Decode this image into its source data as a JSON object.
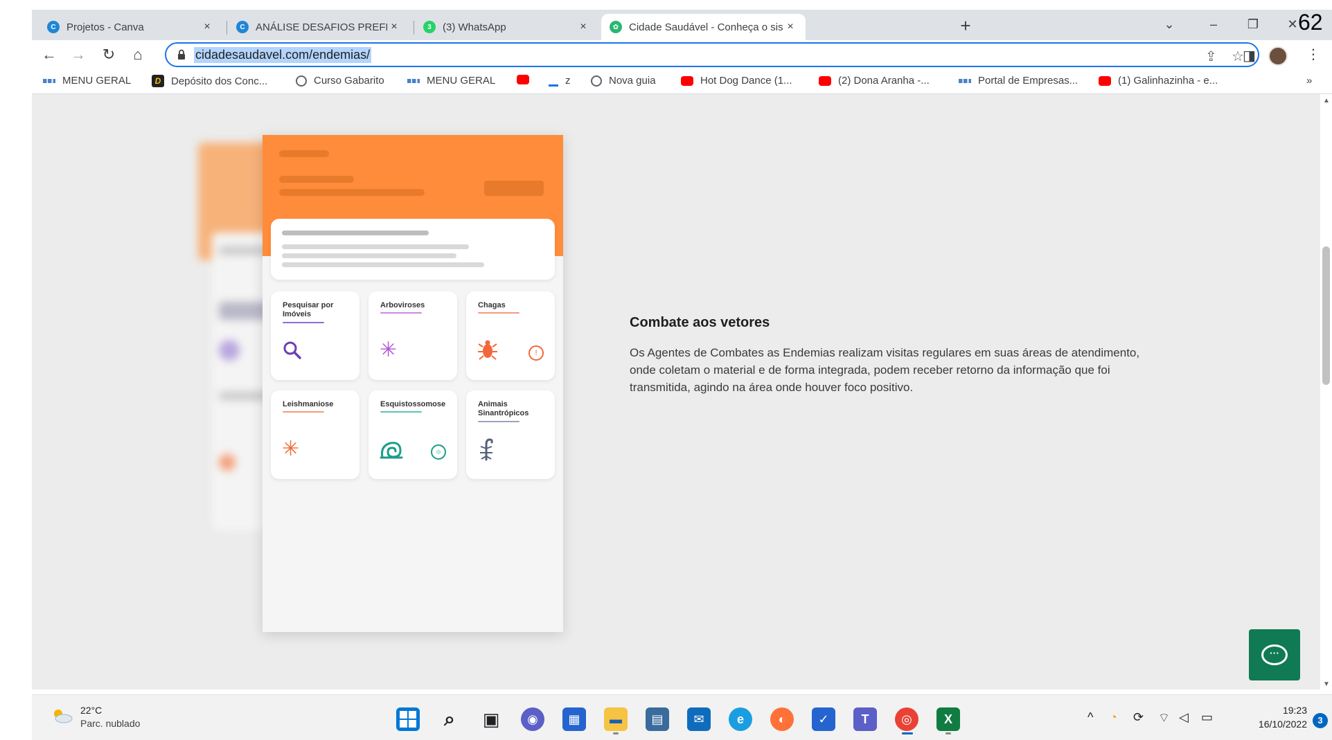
{
  "browser": {
    "tabs": [
      {
        "title": "Projetos - Canva",
        "icon": "canva-icon",
        "color": "#1f86d6",
        "active": false
      },
      {
        "title": "ANÁLISE DESAFIOS PREFEITURA",
        "icon": "canva-icon",
        "color": "#1f86d6",
        "active": false
      },
      {
        "title": "(3) WhatsApp",
        "icon": "whatsapp-icon",
        "color": "#25d366",
        "active": false
      },
      {
        "title": "Cidade Saudável - Conheça o sis",
        "icon": "cidade-saudavel-icon",
        "color": "#2bb673",
        "active": true
      }
    ],
    "close_glyph": "×",
    "new_tab_glyph": "+",
    "url": "cidadesaudavel.com/endemias/",
    "overlay_number": "62"
  },
  "bookmarks": [
    {
      "label": "MENU GERAL",
      "icon": "grid-icon"
    },
    {
      "label": "Depósito dos Conc...",
      "icon": "d-logo-icon"
    },
    {
      "label": "Curso Gabarito",
      "icon": "globe-icon"
    },
    {
      "label": "MENU GERAL",
      "icon": "grid-icon"
    },
    {
      "label": "",
      "icon": "youtube-icon"
    },
    {
      "label": "z",
      "icon": "download-icon"
    },
    {
      "label": "Nova guia",
      "icon": "globe-icon"
    },
    {
      "label": "Hot Dog Dance (1...",
      "icon": "youtube-icon"
    },
    {
      "label": "(2) Dona Aranha -...",
      "icon": "youtube-icon"
    },
    {
      "label": "Portal de Empresas...",
      "icon": "grid-icon"
    },
    {
      "label": "(1) Galinhazinha - e...",
      "icon": "youtube-icon"
    }
  ],
  "bookmarks_more": "»",
  "mockup": {
    "tiles": [
      {
        "label": "Pesquisar por Imóveis",
        "icon": "search-icon",
        "glyph": "🔍",
        "color": "#6a3fb5",
        "badge": ""
      },
      {
        "label": "Arboviroses",
        "icon": "mosquito-icon",
        "glyph": "✳",
        "color": "#b256d6",
        "badge": ""
      },
      {
        "label": "Chagas",
        "icon": "bug-icon",
        "glyph": "🐞",
        "color": "#f2683a",
        "badge": "!"
      },
      {
        "label": "Leishmaniose",
        "icon": "sandfly-icon",
        "glyph": "✳",
        "color": "#f2683a",
        "badge": ""
      },
      {
        "label": "Esquistossomose",
        "icon": "snail-icon",
        "glyph": "@",
        "color": "#1a9e8a",
        "badge": "⟐"
      },
      {
        "label": "Animais Sinantrópicos",
        "icon": "scorpion-icon",
        "glyph": "ᛘ",
        "color": "#56607a",
        "badge": ""
      }
    ]
  },
  "content": {
    "heading": "Combate aos vetores",
    "paragraph": "Os Agentes de Combates as Endemias realizam visitas regulares em suas áreas de atendimento, onde coletam o material e de forma integrada, podem receber retorno da informação que foi transmitida, agindo na área onde houver foco positivo."
  },
  "chat": {
    "glyph": "···",
    "color": "#107a55"
  },
  "taskbar": {
    "weather_temp": "22°C",
    "weather_desc": "Parc. nublado",
    "apps": [
      {
        "name": "windows-start-icon",
        "color": "#0078d4",
        "glyph": "⊞"
      },
      {
        "name": "search-icon",
        "color": "#f2f2f2",
        "glyph": "⌕"
      },
      {
        "name": "task-view-icon",
        "color": "#f2f2f2",
        "glyph": "▣"
      },
      {
        "name": "teams-chat-icon",
        "color": "#5b5fc7",
        "glyph": "◉"
      },
      {
        "name": "store-icon",
        "color": "#2564cf",
        "glyph": "▦"
      },
      {
        "name": "file-explorer-icon",
        "color": "#f6c343",
        "glyph": "▬"
      },
      {
        "name": "amazon-icon",
        "color": "#3a6b9c",
        "glyph": "▤"
      },
      {
        "name": "mail-icon",
        "color": "#0f6cbd",
        "glyph": "✉"
      },
      {
        "name": "edge-icon",
        "color": "#1b9de2",
        "glyph": "e"
      },
      {
        "name": "firefox-icon",
        "color": "#ff7139",
        "glyph": "◐"
      },
      {
        "name": "todo-icon",
        "color": "#2564cf",
        "glyph": "✓"
      },
      {
        "name": "teams-icon",
        "color": "#5b5fc7",
        "glyph": "T"
      },
      {
        "name": "chrome-icon",
        "color": "#e94235",
        "glyph": "◎"
      },
      {
        "name": "excel-icon",
        "color": "#107c41",
        "glyph": "X"
      }
    ],
    "tray": {
      "chevron": "^",
      "time": "19:23",
      "date": "16/10/2022",
      "notifications": "3"
    }
  }
}
